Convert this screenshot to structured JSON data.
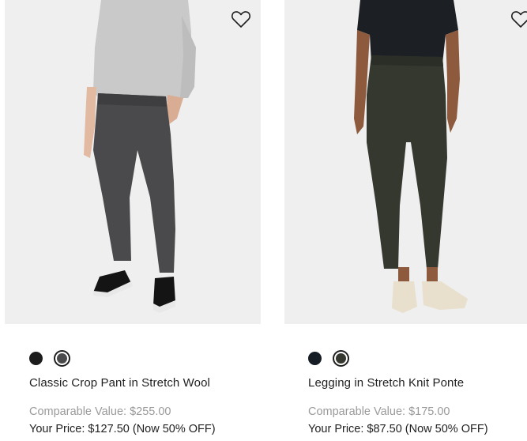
{
  "products": [
    {
      "name": "Classic Crop Pant in Stretch Wool",
      "image_alt": "Model wearing grey plaid cropped pants with a light grey sweater and black sneakers",
      "comparable_value": "Comparable Value: $255.00",
      "your_price": "Your Price: $127.50 (Now 50% OFF)",
      "swatches": [
        {
          "color": "#1c1c1c",
          "selected": false
        },
        {
          "color": "#4a4a4c",
          "selected": true
        }
      ],
      "wishlist_icon": "heart-outline-icon"
    },
    {
      "name": "Legging in Stretch Knit Ponte",
      "image_alt": "Model wearing dark olive leggings with a black t-shirt and cream slip-on shoes",
      "comparable_value": "Comparable Value: $175.00",
      "your_price": "Your Price: $87.50 (Now 50% OFF)",
      "swatches": [
        {
          "color": "#161c24",
          "selected": false
        },
        {
          "color": "#34382f",
          "selected": true
        }
      ],
      "wishlist_icon": "heart-outline-icon"
    }
  ]
}
